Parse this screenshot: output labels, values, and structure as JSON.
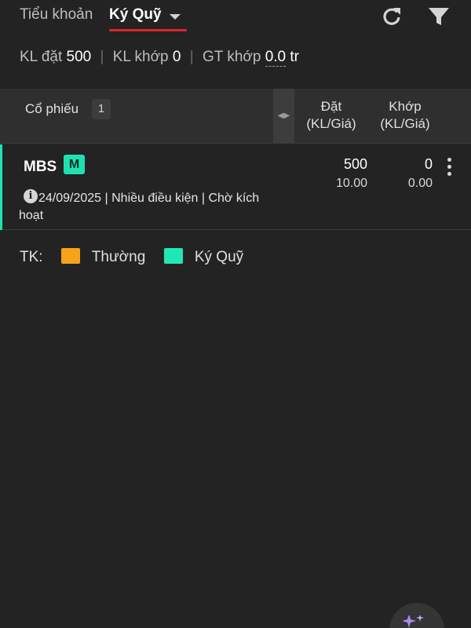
{
  "header": {
    "account_label": "Tiểu khoản",
    "account_value": "Ký Quỹ",
    "accent_color": "#e0222c"
  },
  "summary": {
    "ordered_label": "KL đặt",
    "ordered_value": "500",
    "matched_label": "KL khớp",
    "matched_value": "0",
    "matched_value_label": "GT khớp",
    "matched_value_amount": "0.0",
    "matched_value_unit": "tr"
  },
  "table": {
    "col_stock": "Cổ phiếu",
    "stock_count": "1",
    "col_ordered": "Đặt",
    "col_ordered_sub": "(KL/Giá)",
    "col_matched": "Khớp",
    "col_matched_sub": "(KL/Giá)",
    "rows": [
      {
        "symbol": "MBS",
        "account_badge": "M",
        "ordered_qty": "500",
        "ordered_price": "10.00",
        "matched_qty": "0",
        "matched_price": "0.00",
        "detail": "24/09/2025 | Nhiều điều kiện |  Chờ kích hoạt"
      }
    ]
  },
  "legend": {
    "label": "TK:",
    "normal": "Thường",
    "margin": "Ký Quỹ",
    "normal_color": "#f7a21b",
    "margin_color": "#1fe8b6"
  },
  "icons": [
    "refresh-icon",
    "filter-icon",
    "chevron-down-icon",
    "resize-handle-icon",
    "more-vertical-icon",
    "info-icon",
    "sparkle-icon"
  ]
}
